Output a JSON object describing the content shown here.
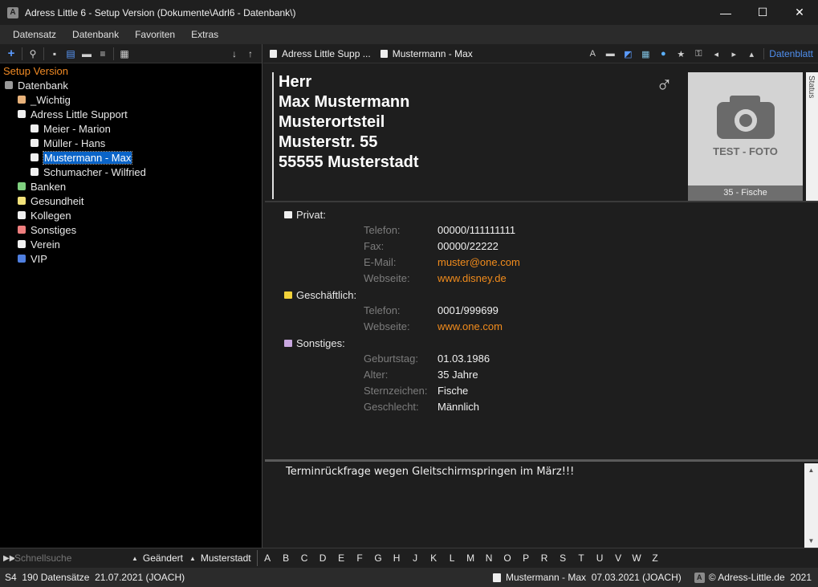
{
  "window": {
    "app_icon_letter": "A",
    "title": "Adress Little 6 - Setup Version (Dokumente\\Adrl6 - Datenbank\\)",
    "minimize": "—",
    "maximize": "☐",
    "close": "✕"
  },
  "menu": [
    "Datensatz",
    "Datenbank",
    "Favoriten",
    "Extras"
  ],
  "left": {
    "setup_label": "Setup Version",
    "tree": [
      {
        "label": "Datenbank",
        "level": 0,
        "color": "#9a9a9a",
        "name": "tree-root-datenbank"
      },
      {
        "label": "_Wichtig",
        "level": 1,
        "color": "#e8b27a",
        "name": "tree-item-wichtig"
      },
      {
        "label": "Adress Little Support",
        "level": 1,
        "color": "#f0f0f0",
        "name": "tree-item-support"
      },
      {
        "label": "Meier - Marion",
        "level": 2,
        "color": "#f0f0f0",
        "name": "tree-item-meier"
      },
      {
        "label": "Müller - Hans",
        "level": 2,
        "color": "#f0f0f0",
        "name": "tree-item-mueller"
      },
      {
        "label": "Mustermann - Max",
        "level": 2,
        "color": "#f0f0f0",
        "name": "tree-item-mustermann",
        "selected": true
      },
      {
        "label": "Schumacher - Wilfried",
        "level": 2,
        "color": "#f0f0f0",
        "name": "tree-item-schumacher"
      },
      {
        "label": "Banken",
        "level": 1,
        "color": "#7fd07f",
        "name": "tree-item-banken"
      },
      {
        "label": "Gesundheit",
        "level": 1,
        "color": "#f2e27a",
        "name": "tree-item-gesundheit"
      },
      {
        "label": "Kollegen",
        "level": 1,
        "color": "#f0f0f0",
        "name": "tree-item-kollegen"
      },
      {
        "label": "Sonstiges",
        "level": 1,
        "color": "#ef7f7f",
        "name": "tree-item-sonstiges"
      },
      {
        "label": "Verein",
        "level": 1,
        "color": "#f0f0f0",
        "name": "tree-item-verein"
      },
      {
        "label": "VIP",
        "level": 1,
        "color": "#4f7fe0",
        "name": "tree-item-vip"
      }
    ]
  },
  "right_toolbar": {
    "crumb1": "Adress Little Supp ...",
    "crumb2": "Mustermann - Max",
    "view_link": "Datenblatt"
  },
  "card": {
    "lines": [
      "Herr",
      "Max Mustermann",
      "Musterortsteil",
      "Musterstr. 55",
      "55555 Musterstadt"
    ],
    "gender_symbol": "♂",
    "photo_text": "TEST - FOTO",
    "photo_caption": "35 - Fische",
    "status_tab": "Status"
  },
  "details": {
    "privat": {
      "title": "Privat:",
      "color": "#f0f0f0",
      "fields": [
        {
          "label": "Telefon:",
          "value": "00000/111111111",
          "link": false
        },
        {
          "label": "Fax:",
          "value": "00000/22222",
          "link": false
        },
        {
          "label": "E-Mail:",
          "value": "muster@one.com",
          "link": true
        },
        {
          "label": "Webseite:",
          "value": "www.disney.de",
          "link": true
        }
      ]
    },
    "geschaeftlich": {
      "title": "Geschäftlich:",
      "color": "#f2d23a",
      "fields": [
        {
          "label": "Telefon:",
          "value": "0001/999699",
          "link": false
        },
        {
          "label": "Webseite:",
          "value": "www.one.com",
          "link": true
        }
      ]
    },
    "sonstiges": {
      "title": "Sonstiges:",
      "color": "#c9a8e0",
      "fields": [
        {
          "label": "Geburtstag:",
          "value": "01.03.1986",
          "link": false
        },
        {
          "label": "Alter:",
          "value": "35 Jahre",
          "link": false
        },
        {
          "label": "Sternzeichen:",
          "value": "Fische",
          "link": false
        },
        {
          "label": "Geschlecht:",
          "value": "Männlich",
          "link": false
        }
      ]
    }
  },
  "notes": {
    "text": "Terminrückfrage wegen Gleitschirmspringen im März!!!"
  },
  "searchbar": {
    "placeholder": "Schnellsuche",
    "sort1": "Geändert",
    "sort2": "Musterstadt",
    "letters": [
      "A",
      "B",
      "C",
      "D",
      "E",
      "F",
      "G",
      "H",
      "J",
      "K",
      "L",
      "M",
      "N",
      "O",
      "P",
      "R",
      "S",
      "T",
      "U",
      "V",
      "W",
      "Z"
    ]
  },
  "status": {
    "left": "S4  190 Datensätze  21.07.2021 (JOACH)",
    "record": "Mustermann - Max  07.03.2021 (JOACH)",
    "copyright": "© Adress-Little.de  2021"
  }
}
